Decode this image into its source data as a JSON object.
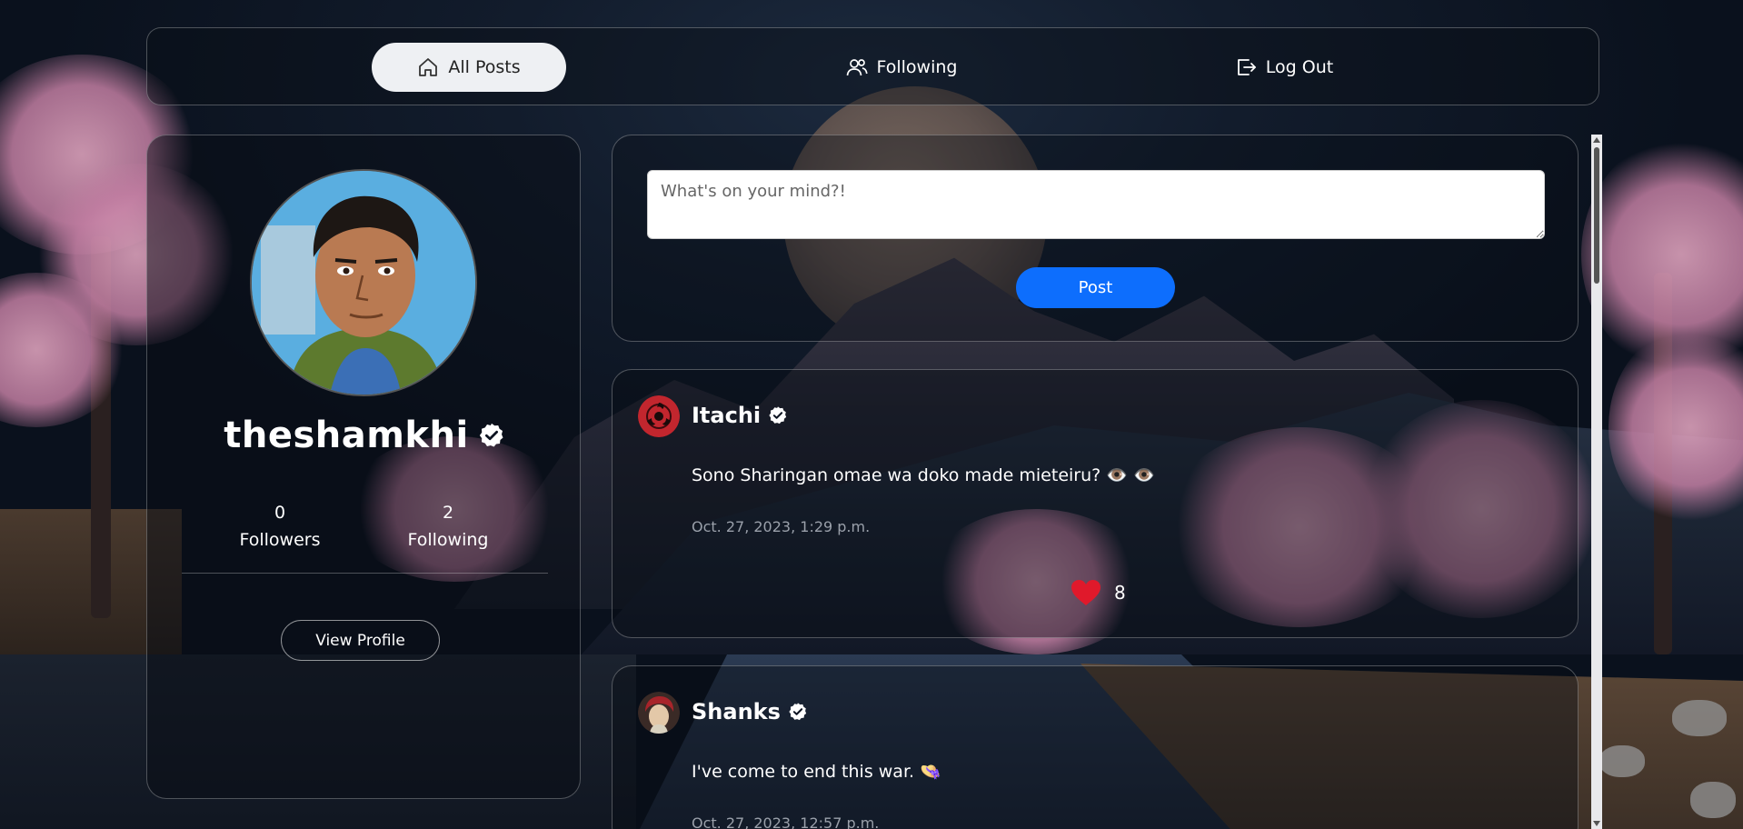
{
  "nav": {
    "all_posts_label": "All Posts",
    "following_label": "Following",
    "logout_label": "Log Out",
    "active": "all_posts"
  },
  "profile": {
    "username": "theshamkhi",
    "verified": true,
    "followers_count": "0",
    "followers_label": "Followers",
    "following_count": "2",
    "following_label": "Following",
    "view_profile_label": "View Profile"
  },
  "composer": {
    "placeholder": "What's on your mind?!",
    "value": "",
    "post_label": "Post"
  },
  "posts": [
    {
      "author": "Itachi",
      "verified": true,
      "avatar_icon": "sharingan-avatar",
      "text": "Sono Sharingan omae wa doko made mieteiru? 👁️ 👁️",
      "timestamp": "Oct. 27, 2023, 1:29 p.m.",
      "likes": "8",
      "liked": true
    },
    {
      "author": "Shanks",
      "verified": true,
      "avatar_icon": "shanks-avatar",
      "text": "I've come to end this war. 👒",
      "timestamp": "Oct. 27, 2023, 12:57 p.m."
    }
  ],
  "colors": {
    "accent": "#0d6efd",
    "heart": "#e0192b",
    "active_nav_bg": "#eef0f3"
  }
}
